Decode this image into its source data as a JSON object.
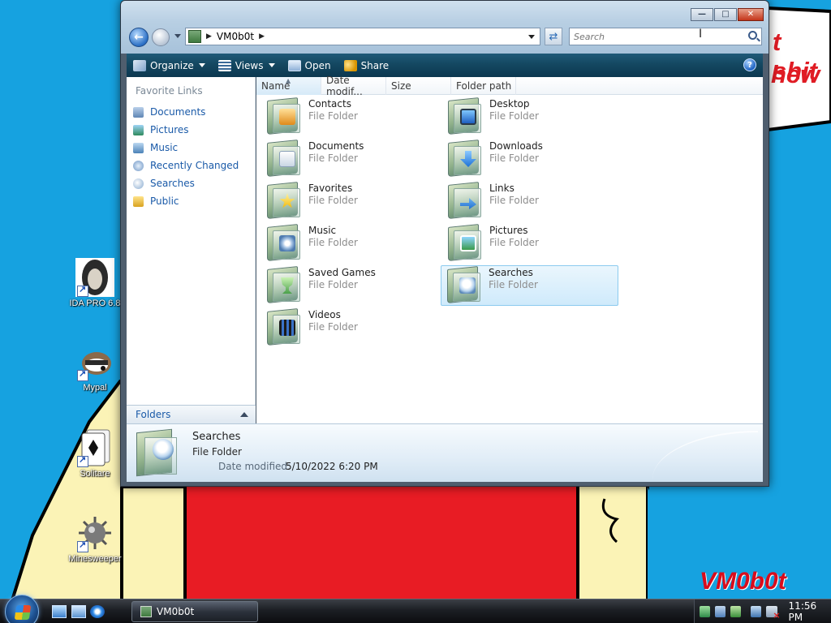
{
  "desktop": {
    "wallpaper_lines": [
      "t shit",
      "hew"
    ],
    "signature": "VM0b0t",
    "icons": [
      {
        "label": "IDA PRO 6.8",
        "icon": "ida-pro-icon"
      },
      {
        "label": "Mypal",
        "icon": "mypal-icon"
      },
      {
        "label": "Solitare",
        "icon": "solitaire-icon"
      },
      {
        "label": "Minesweeper",
        "icon": "minesweeper-icon"
      }
    ]
  },
  "window": {
    "address": {
      "crumb": "VM0b0t"
    },
    "search": {
      "placeholder": "Search"
    },
    "toolbar": {
      "organize": "Organize",
      "views": "Views",
      "open": "Open",
      "share": "Share",
      "help": "?"
    },
    "nav_pane": {
      "heading": "Favorite Links",
      "links": [
        "Documents",
        "Pictures",
        "Music",
        "Recently Changed",
        "Searches",
        "Public"
      ],
      "folders_label": "Folders"
    },
    "columns": [
      "Name",
      "Date modif...",
      "Size",
      "Folder path"
    ],
    "items": [
      {
        "name": "Contacts",
        "type": "File Folder",
        "icon": "contacts-folder-icon"
      },
      {
        "name": "Desktop",
        "type": "File Folder",
        "icon": "desktop-folder-icon"
      },
      {
        "name": "Documents",
        "type": "File Folder",
        "icon": "documents-folder-icon"
      },
      {
        "name": "Downloads",
        "type": "File Folder",
        "icon": "downloads-folder-icon"
      },
      {
        "name": "Favorites",
        "type": "File Folder",
        "icon": "favorites-folder-icon"
      },
      {
        "name": "Links",
        "type": "File Folder",
        "icon": "links-folder-icon"
      },
      {
        "name": "Music",
        "type": "File Folder",
        "icon": "music-folder-icon"
      },
      {
        "name": "Pictures",
        "type": "File Folder",
        "icon": "pictures-folder-icon"
      },
      {
        "name": "Saved Games",
        "type": "File Folder",
        "icon": "saved-games-folder-icon"
      },
      {
        "name": "Searches",
        "type": "File Folder",
        "icon": "searches-folder-icon",
        "selected": true
      },
      {
        "name": "Videos",
        "type": "File Folder",
        "icon": "videos-folder-icon"
      }
    ],
    "details": {
      "name": "Searches",
      "type": "File Folder",
      "date_label": "Date modified:",
      "date_value": "5/10/2022 6:20 PM"
    }
  },
  "taskbar": {
    "task_button": "VM0b0t",
    "clock": "11:56 PM"
  }
}
